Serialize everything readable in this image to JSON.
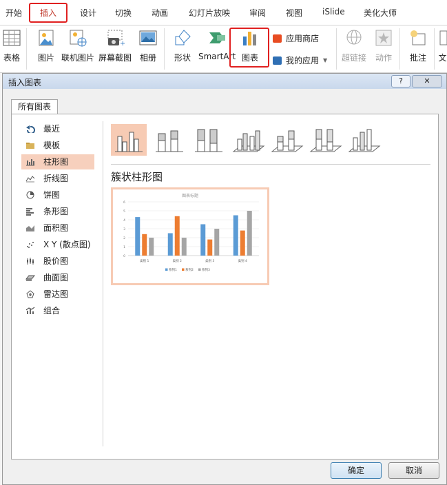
{
  "ribbon_tabs": [
    "开始",
    "插入",
    "设计",
    "切换",
    "动画",
    "幻灯片放映",
    "审阅",
    "视图",
    "iSlide",
    "美化大师"
  ],
  "ribbon": {
    "table": "表格",
    "picture": "图片",
    "online_picture": "联机图片",
    "screenshot": "屏幕截图",
    "album": "相册",
    "shapes": "形状",
    "smartart": "SmartArt",
    "chart": "图表",
    "app_store": "应用商店",
    "my_apps": "我的应用",
    "hyperlink": "超链接",
    "action": "动作",
    "comment": "批注",
    "text_cut": "文"
  },
  "dialog": {
    "title": "插入图表",
    "help": "?",
    "close": "✕",
    "tab": "所有图表",
    "categories": [
      "最近",
      "模板",
      "柱形图",
      "折线图",
      "饼图",
      "条形图",
      "面积图",
      "X Y (散点图)",
      "股价图",
      "曲面图",
      "雷达图",
      "组合"
    ],
    "selected_category": "柱形图",
    "subtype_title": "簇状柱形图",
    "ok": "确定",
    "cancel": "取消"
  },
  "colors": {
    "accent_red": "#e02020",
    "selected_bg": "#f7cbb4",
    "series1": "#5b9bd5",
    "series2": "#ed7d31",
    "series3": "#a5a5a5"
  },
  "chart_data": {
    "type": "bar",
    "title": "图表标题",
    "categories": [
      "类别 1",
      "类别 2",
      "类别 3",
      "类别 4"
    ],
    "series": [
      {
        "name": "系列1",
        "values": [
          4.3,
          2.5,
          3.5,
          4.5
        ]
      },
      {
        "name": "系列2",
        "values": [
          2.4,
          4.4,
          1.8,
          2.8
        ]
      },
      {
        "name": "系列3",
        "values": [
          2,
          2,
          3,
          5
        ]
      }
    ],
    "yticks": [
      "0",
      "1",
      "2",
      "3",
      "4",
      "5",
      "6"
    ],
    "ylim": [
      0,
      6
    ],
    "grid": true,
    "legend": "bottom"
  }
}
